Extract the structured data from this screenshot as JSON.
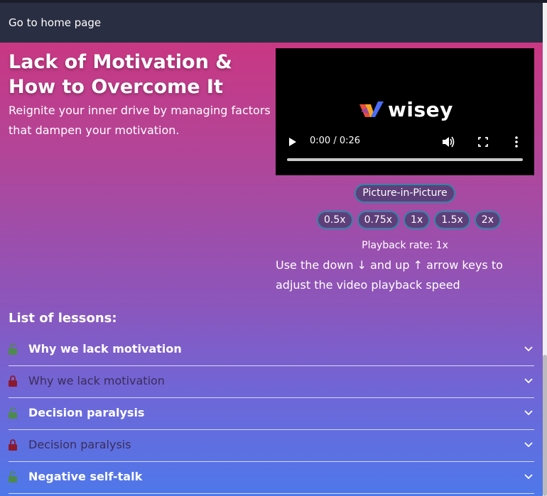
{
  "header": {
    "home_link": "Go to home page"
  },
  "course": {
    "title": "Lack of Motivation & How to Overcome It",
    "subtitle": "Reignite your inner drive by managing factors that dampen your motivation."
  },
  "video": {
    "brand": "wisey",
    "time": "0:00 / 0:26",
    "pip_label": "Picture-in-Picture",
    "rates": [
      "0.5x",
      "0.75x",
      "1x",
      "1.5x",
      "2x"
    ],
    "rate_label": "Playback rate: 1x",
    "hint": "Use the down ↓ and up ↑ arrow keys to adjust the video playback speed"
  },
  "lessons": {
    "title": "List of lessons:",
    "items": [
      {
        "label": "Why we lack motivation",
        "locked": false
      },
      {
        "label": "Why we lack motivation",
        "locked": true
      },
      {
        "label": "Decision paralysis",
        "locked": false
      },
      {
        "label": "Decision paralysis",
        "locked": true
      },
      {
        "label": "Negative self-talk",
        "locked": false
      }
    ]
  },
  "colors": {
    "unlock": "#4e8a4e",
    "lock": "#8b1a2e",
    "pill_border": "#2f86a8"
  }
}
